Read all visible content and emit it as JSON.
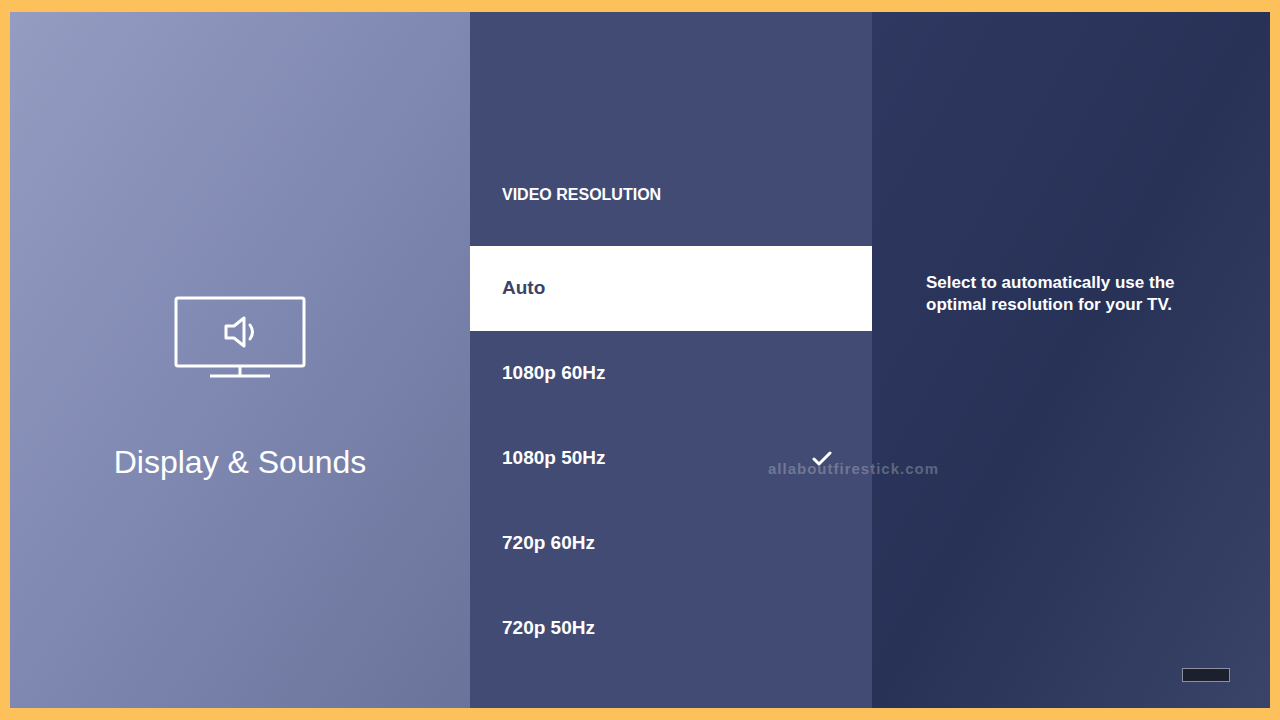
{
  "sidebar": {
    "title": "Display & Sounds"
  },
  "menu": {
    "heading": "VIDEO RESOLUTION",
    "options": [
      {
        "label": "Auto",
        "selected": true,
        "checked": false
      },
      {
        "label": "1080p 60Hz",
        "selected": false,
        "checked": false
      },
      {
        "label": "1080p 50Hz",
        "selected": false,
        "checked": true
      },
      {
        "label": "720p 60Hz",
        "selected": false,
        "checked": false
      },
      {
        "label": "720p 50Hz",
        "selected": false,
        "checked": false
      }
    ]
  },
  "description": "Select to automatically use the optimal resolution for your TV.",
  "watermark": "allaboutfirestick.com"
}
